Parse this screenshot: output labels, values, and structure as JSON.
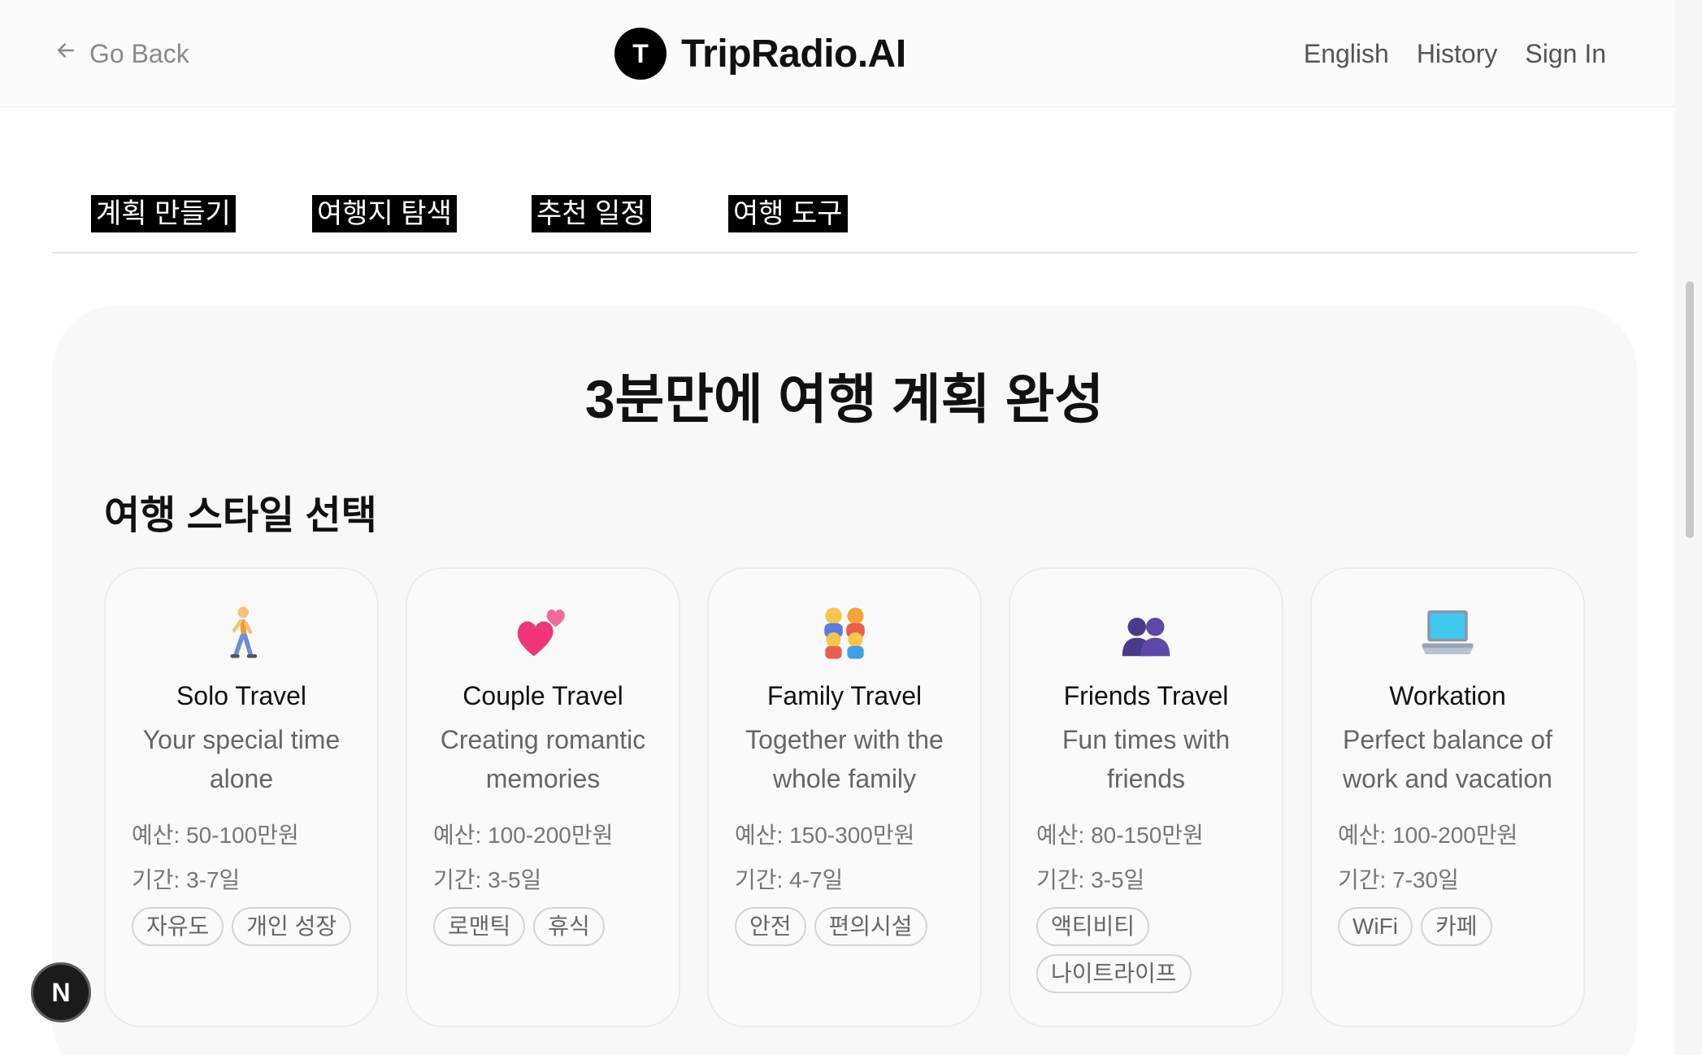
{
  "header": {
    "back_label": "Go Back",
    "brand_initial": "T",
    "brand_name": "TripRadio.AI",
    "nav": [
      "English",
      "History",
      "Sign In"
    ]
  },
  "tabs": [
    "계획 만들기",
    "여행지 탐색",
    "추천 일정",
    "여행 도구"
  ],
  "main": {
    "headline": "3분만에 여행 계획 완성",
    "section_title": "여행 스타일 선택"
  },
  "cards": [
    {
      "icon": "person-walking-icon",
      "title": "Solo Travel",
      "desc": "Your special time alone",
      "budget": "예산: 50-100만원",
      "duration": "기간: 3-7일",
      "tags": [
        "자유도",
        "개인 성장"
      ]
    },
    {
      "icon": "two-hearts-icon",
      "title": "Couple Travel",
      "desc": "Creating romantic memories",
      "budget": "예산: 100-200만원",
      "duration": "기간: 3-5일",
      "tags": [
        "로맨틱",
        "휴식"
      ]
    },
    {
      "icon": "family-icon",
      "title": "Family Travel",
      "desc": "Together with the whole family",
      "budget": "예산: 150-300만원",
      "duration": "기간: 4-7일",
      "tags": [
        "안전",
        "편의시설"
      ]
    },
    {
      "icon": "people-silhouette-icon",
      "title": "Friends Travel",
      "desc": "Fun times with friends",
      "budget": "예산: 80-150만원",
      "duration": "기간: 3-5일",
      "tags": [
        "액티비티",
        "나이트라이프"
      ]
    },
    {
      "icon": "laptop-icon",
      "title": "Workation",
      "desc": "Perfect balance of work and vacation",
      "budget": "예산: 100-200만원",
      "duration": "기간: 7-30일",
      "tags": [
        "WiFi",
        "카페"
      ]
    }
  ],
  "floating_button_label": "N",
  "colors": {
    "accent": "#000000",
    "panel_bg": "#f8f8f8",
    "muted_text": "#666666"
  }
}
